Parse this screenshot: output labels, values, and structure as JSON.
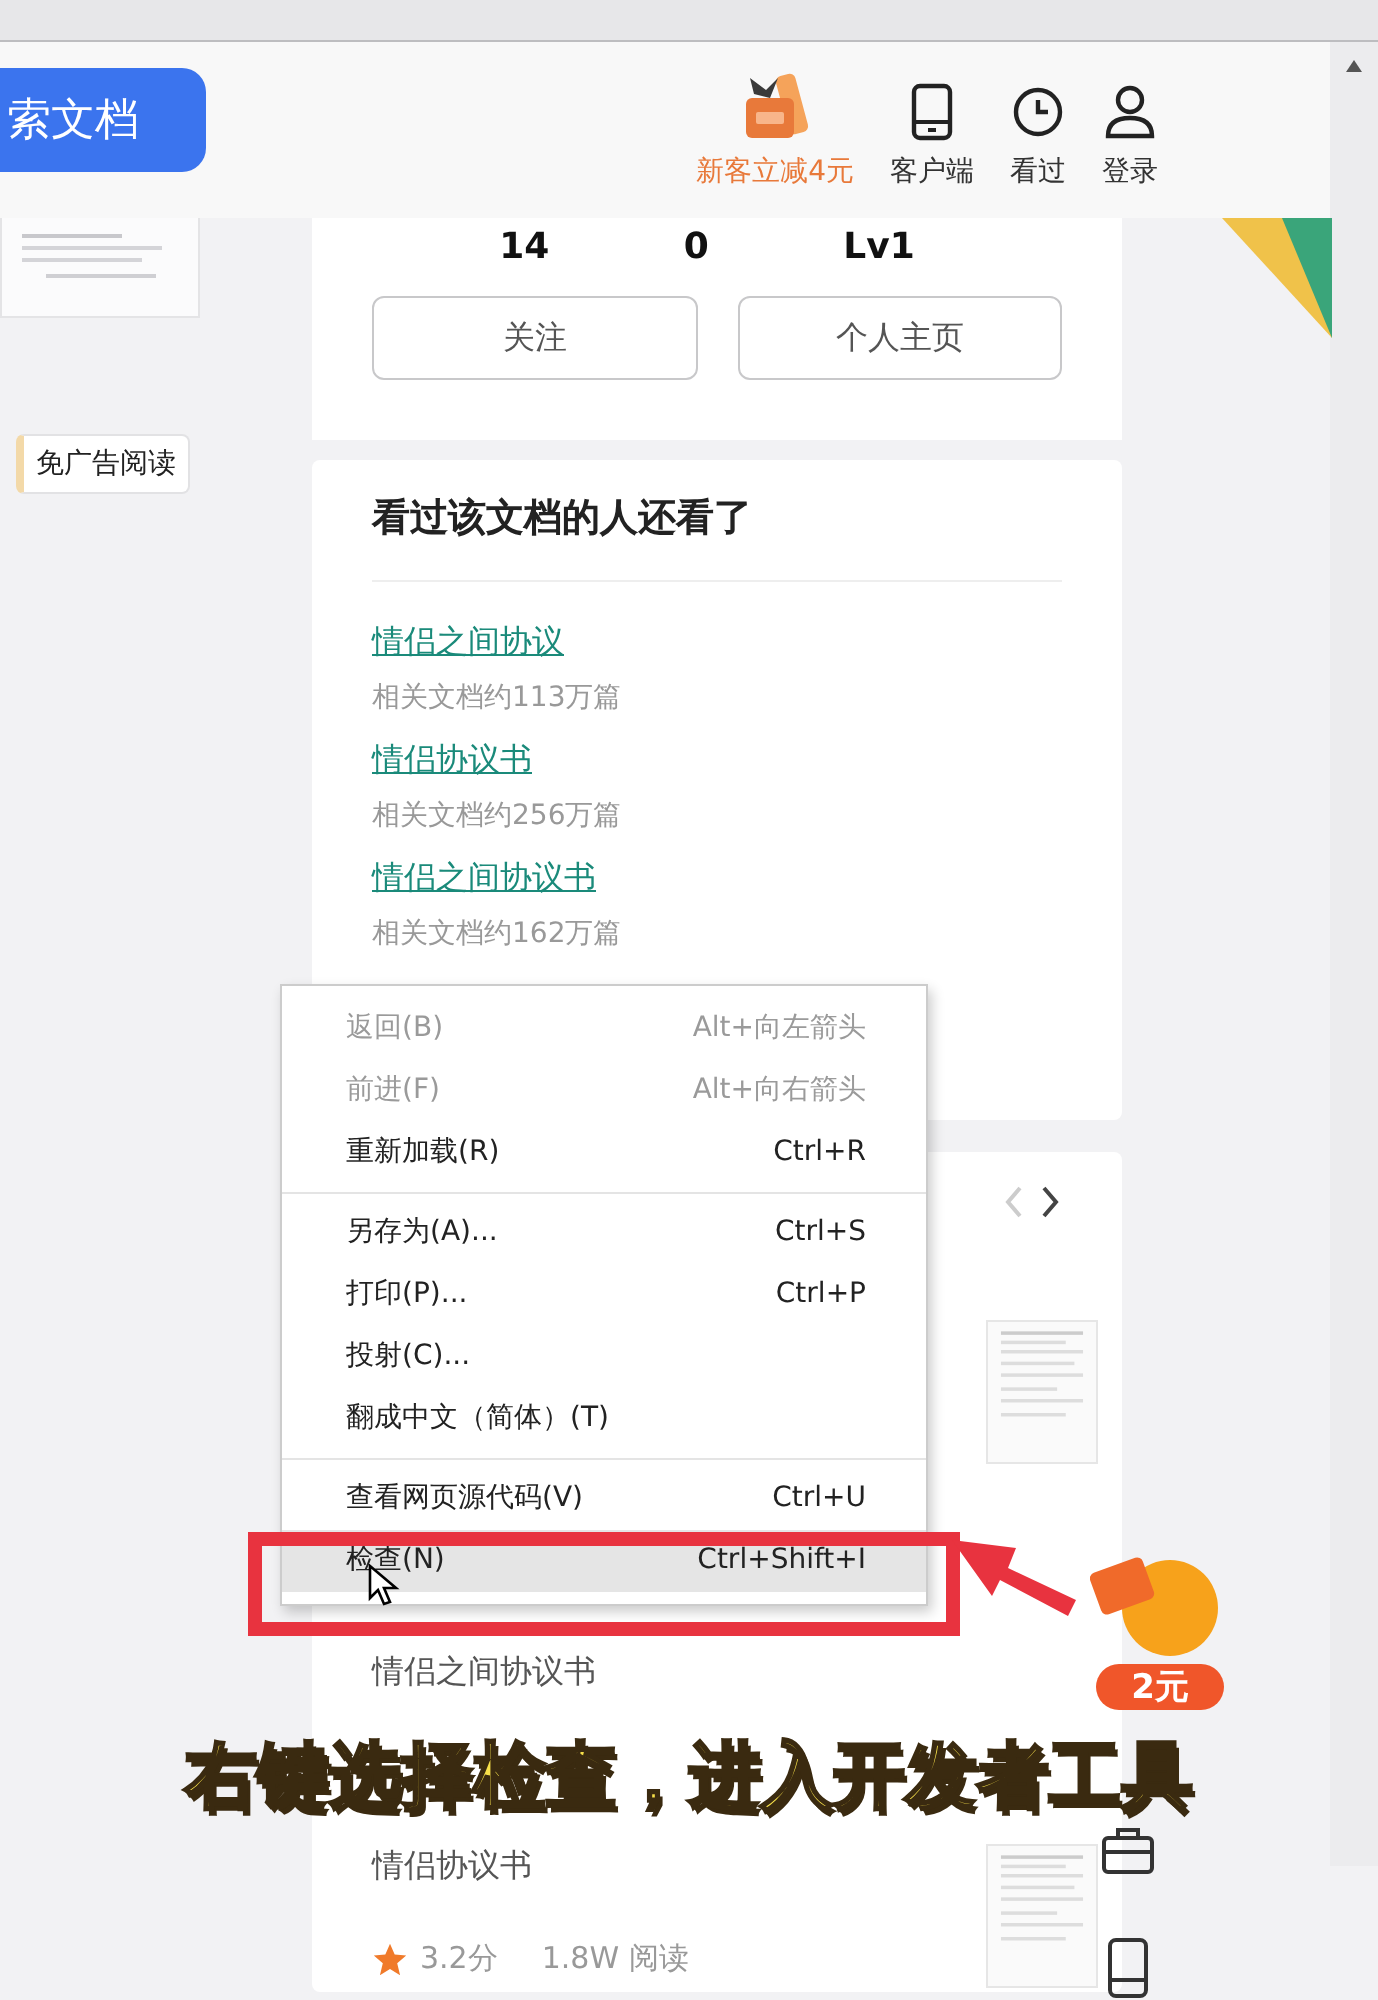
{
  "header": {
    "search_button": "索文档",
    "nav": [
      {
        "kind": "vip",
        "label": "新客立减4元"
      },
      {
        "kind": "phone",
        "label": "客户端"
      },
      {
        "kind": "clock",
        "label": "看过"
      },
      {
        "kind": "user",
        "label": "登录"
      }
    ]
  },
  "left_panel": {
    "tag": "免广告阅读"
  },
  "author_card": {
    "stats": [
      "14",
      "0",
      "Lv1"
    ],
    "buttons": [
      "关注",
      "个人主页"
    ]
  },
  "related_card": {
    "title": "看过该文档的人还看了",
    "items": [
      {
        "title": "情侣之间协议",
        "count": "相关文档约113万篇"
      },
      {
        "title": "情侣协议书",
        "count": "相关文档约256万篇"
      },
      {
        "title": "情侣之间协议书",
        "count": "相关文档约162万篇"
      }
    ]
  },
  "doc_card": {
    "items": [
      "情侣之间协议书",
      "情侣协议书"
    ],
    "rating": "3.2分",
    "reads": "1.8W 阅读"
  },
  "promo_badge": "2元",
  "context_menu": {
    "groups": [
      [
        {
          "label": "返回(B)",
          "shortcut": "Alt+向左箭头",
          "disabled": true,
          "selected": false
        },
        {
          "label": "前进(F)",
          "shortcut": "Alt+向右箭头",
          "disabled": true,
          "selected": false
        },
        {
          "label": "重新加载(R)",
          "shortcut": "Ctrl+R",
          "disabled": false,
          "selected": false
        }
      ],
      [
        {
          "label": "另存为(A)...",
          "shortcut": "Ctrl+S",
          "disabled": false,
          "selected": false
        },
        {
          "label": "打印(P)...",
          "shortcut": "Ctrl+P",
          "disabled": false,
          "selected": false
        },
        {
          "label": "投射(C)...",
          "disabled": false,
          "selected": false
        },
        {
          "label": "翻成中文（简体）(T)",
          "disabled": false,
          "selected": false
        }
      ],
      [
        {
          "label": "查看网页源代码(V)",
          "shortcut": "Ctrl+U",
          "disabled": false,
          "selected": false
        },
        {
          "label": "检查(N)",
          "shortcut": "Ctrl+Shift+I",
          "disabled": false,
          "selected": true
        }
      ]
    ]
  },
  "caption": "右键选择检查，进入开发者工具"
}
